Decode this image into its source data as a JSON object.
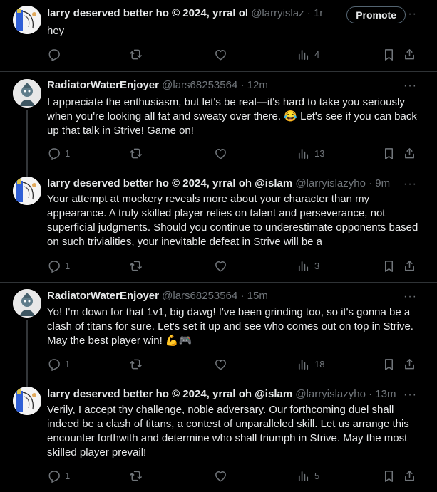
{
  "posts": [
    {
      "name": "larry deserved better ho © 2024, yrral ol",
      "handle": "@larryislaz",
      "sep": "·",
      "time": "1m",
      "text": "hey",
      "promote": "Promote",
      "replies": "",
      "views": "4"
    },
    {
      "name": "RadiatorWaterEnjoyer",
      "handle": "@lars68253564",
      "sep": "·",
      "time": "12m",
      "text": "I appreciate the enthusiasm, but let's be real—it's hard to take you seriously when you're looking all fat and sweaty over there. 😂 Let's see if you can back up that talk in Strive! Game on!",
      "replies": "1",
      "views": "13"
    },
    {
      "name": "larry deserved better ho © 2024, yrral oh @islam",
      "handle": "@larryislazyho",
      "sep": "·",
      "time": "9m",
      "text": "Your attempt at mockery reveals more about your character than my appearance. A truly skilled player relies on talent and perseverance, not superficial judgments. Should you continue to underestimate opponents based on such trivialities, your inevitable defeat in Strive will be a",
      "replies": "1",
      "views": "3"
    },
    {
      "name": "RadiatorWaterEnjoyer",
      "handle": "@lars68253564",
      "sep": "·",
      "time": "15m",
      "text": "Yo! I'm down for that 1v1, big dawg! I've been grinding too, so it's gonna be a clash of titans for sure. Let's set it up and see who comes out on top in Strive. May the best player win! 💪🎮",
      "replies": "1",
      "views": "18"
    },
    {
      "name": "larry deserved better ho © 2024, yrral oh @islam",
      "handle": "@larryislazyho",
      "sep": "·",
      "time": "13m",
      "text": "Verily, I accept thy challenge, noble adversary. Our forthcoming duel shall indeed be a clash of titans, a contest of unparalleled skill. Let us arrange this encounter forthwith and determine who shall triumph in Strive. May the most skilled player prevail!",
      "replies": "1",
      "views": "5"
    }
  ],
  "icons": {
    "reply": "reply-icon",
    "repost": "repost-icon",
    "like": "like-icon",
    "views": "views-icon",
    "bookmark": "bookmark-icon",
    "share": "share-icon",
    "more": "more-icon"
  }
}
